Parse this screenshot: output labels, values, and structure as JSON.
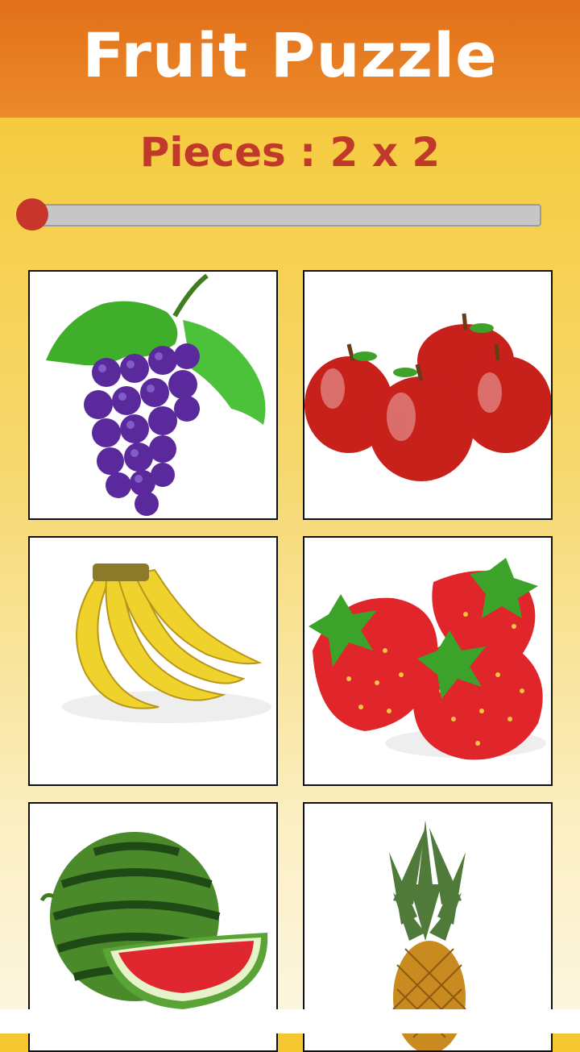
{
  "header": {
    "title": "Fruit Puzzle"
  },
  "pieces": {
    "label": "Pieces : 2 x 2"
  },
  "slider": {
    "value": "2 x 2"
  },
  "tiles": [
    {
      "name": "grapes-tile",
      "icon": "grapes-icon"
    },
    {
      "name": "apples-tile",
      "icon": "apples-icon"
    },
    {
      "name": "bananas-tile",
      "icon": "bananas-icon"
    },
    {
      "name": "strawberries-tile",
      "icon": "strawberries-icon"
    },
    {
      "name": "watermelon-tile",
      "icon": "watermelon-icon"
    },
    {
      "name": "pineapple-tile",
      "icon": "pineapple-icon"
    }
  ],
  "colors": {
    "header": "#e2701a",
    "accent": "#c0392b",
    "slider_thumb": "#c8352a"
  }
}
